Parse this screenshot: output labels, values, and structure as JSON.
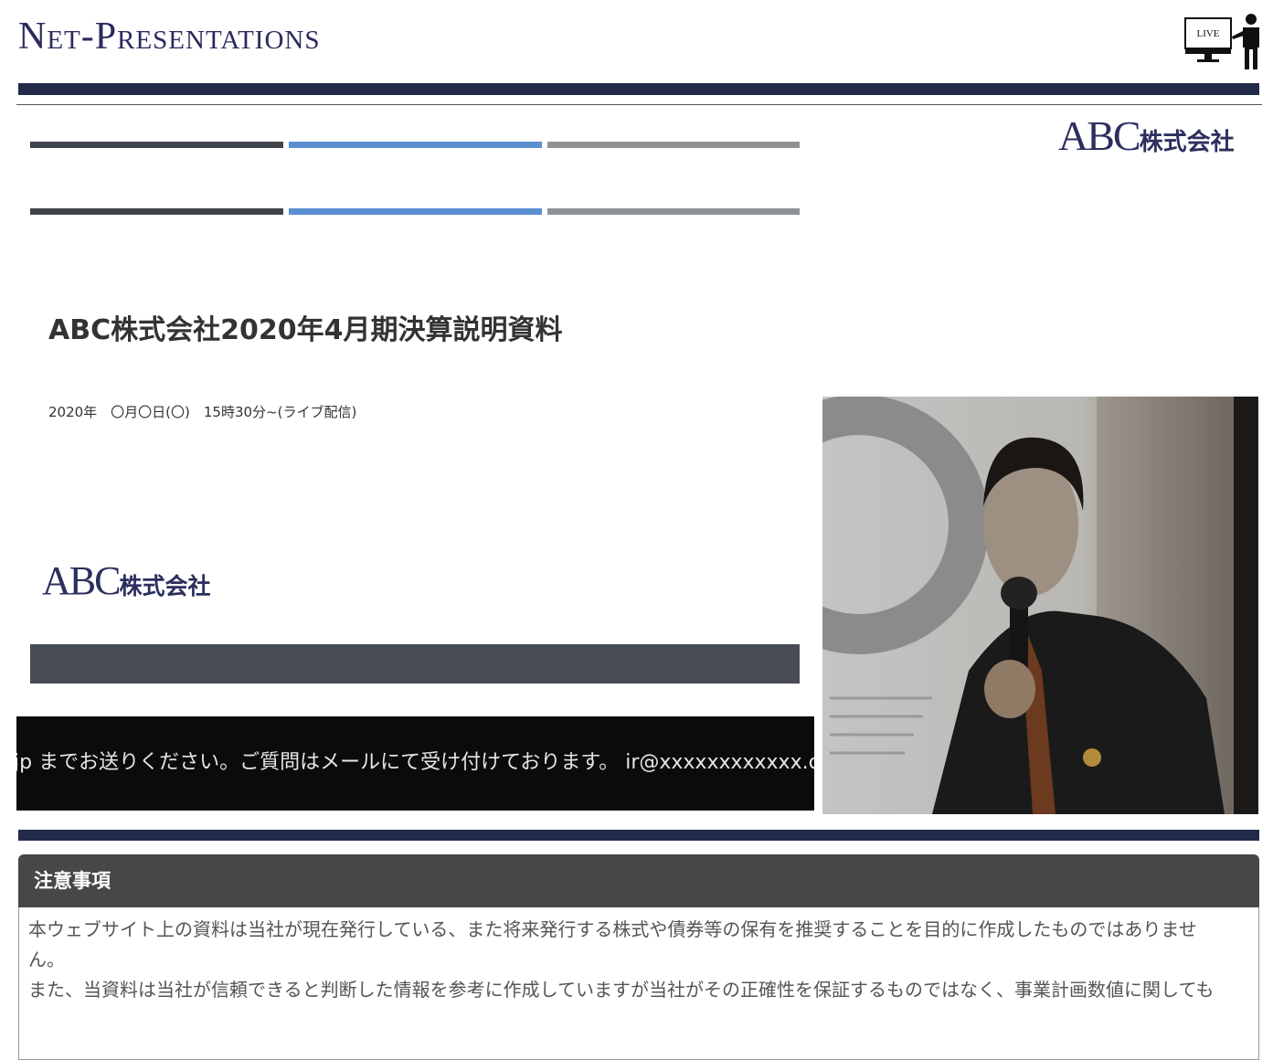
{
  "header": {
    "brand": "Net-Presentations",
    "live_label": "LIVE"
  },
  "slide": {
    "company_logo_latin": "ABC",
    "company_logo_jp": "株式会社",
    "title": "ABC株式会社2020年4月期決算説明資料",
    "date": "2020年　〇月〇日(〇)　15時30分~(ライブ配信)",
    "stripe_colors": [
      "#3f434a",
      "#5b8fd1",
      "#8f9396"
    ]
  },
  "ticker": {
    "text": "jp までお送りください。ご質問はメールにて受け付けております。 ir@xxxxxxxxxxxx.co"
  },
  "notice": {
    "heading": "注意事項",
    "lines": [
      "本ウェブサイト上の資料は当社が現在発行している、また将来発行する株式や債券等の保有を推奨することを目的に作成したものではありませ",
      "ん。",
      "また、当資料は当社が信頼できると判断した情報を参考に作成していますが当社がその正確性を保証するものではなく、事業計画数値に関しても"
    ]
  },
  "colors": {
    "brand_navy": "#222a4a",
    "notice_header": "#474747"
  }
}
